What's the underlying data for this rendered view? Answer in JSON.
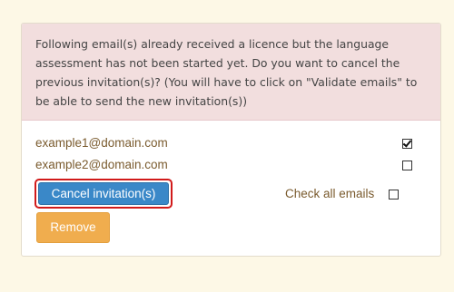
{
  "alert": {
    "message": "Following email(s) already received a licence but the language assessment has not been started yet. Do you want to cancel the previous invitation(s)? (You will have to click on \"Validate emails\" to be able to send the new invitation(s))"
  },
  "emails": [
    {
      "address": "example1@domain.com",
      "checked": true
    },
    {
      "address": "example2@domain.com",
      "checked": false
    }
  ],
  "actions": {
    "cancel_label": "Cancel invitation(s)",
    "check_all_label": "Check all emails",
    "check_all_checked": false,
    "remove_label": "Remove"
  },
  "colors": {
    "page_background": "#fdf8e6",
    "alert_background": "#f2dede",
    "primary_button": "#3a88c8",
    "warning_button": "#f0ad4e",
    "highlight_outline": "#d11a1a",
    "email_text": "#7a5b2e"
  }
}
